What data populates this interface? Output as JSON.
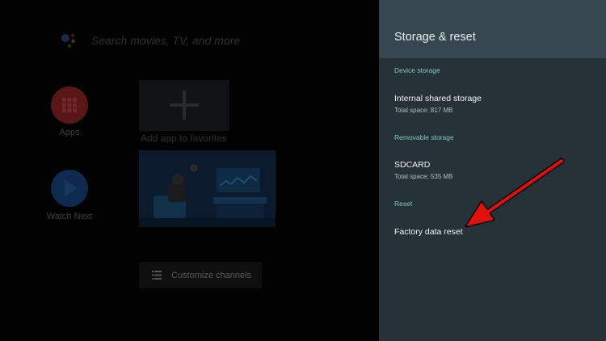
{
  "launcher": {
    "search_placeholder": "Search movies, TV, and more",
    "apps_label": "Apps",
    "watch_next_label": "Watch Next",
    "add_favorites_label": "Add app to favorites",
    "customize_channels_label": "Customize channels"
  },
  "settings": {
    "title": "Storage & reset",
    "sections": {
      "device_storage": "Device storage",
      "removable_storage": "Removable storage",
      "reset": "Reset"
    },
    "items": {
      "internal": {
        "title": "Internal shared storage",
        "subtitle": "Total space: 817 MB"
      },
      "sdcard": {
        "title": "SDCARD",
        "subtitle": "Total space: 535 MB"
      },
      "factory_reset": {
        "title": "Factory data reset"
      }
    }
  },
  "colors": {
    "panel_bg": "#263238",
    "header_bg": "#37474f",
    "section_accent": "#80cbc4",
    "annotation_arrow": "#e0100f"
  },
  "icons": [
    "google-assistant-icon",
    "apps-grid-icon",
    "play-icon",
    "plus-icon",
    "list-icon",
    "annotation-arrow"
  ]
}
